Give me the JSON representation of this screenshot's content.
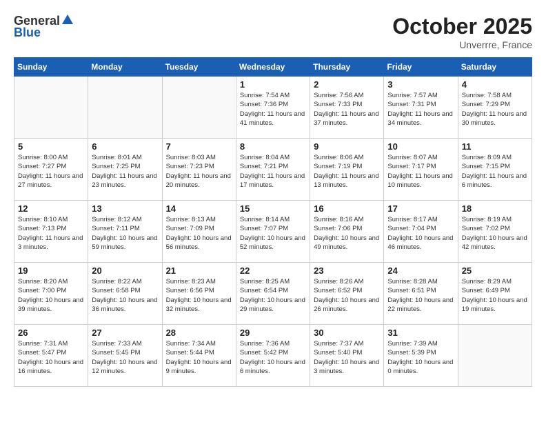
{
  "header": {
    "logo_general": "General",
    "logo_blue": "Blue",
    "month_title": "October 2025",
    "location": "Unverrre, France"
  },
  "days_of_week": [
    "Sunday",
    "Monday",
    "Tuesday",
    "Wednesday",
    "Thursday",
    "Friday",
    "Saturday"
  ],
  "weeks": [
    [
      {
        "day": "",
        "info": ""
      },
      {
        "day": "",
        "info": ""
      },
      {
        "day": "",
        "info": ""
      },
      {
        "day": "1",
        "info": "Sunrise: 7:54 AM\nSunset: 7:36 PM\nDaylight: 11 hours\nand 41 minutes."
      },
      {
        "day": "2",
        "info": "Sunrise: 7:56 AM\nSunset: 7:33 PM\nDaylight: 11 hours\nand 37 minutes."
      },
      {
        "day": "3",
        "info": "Sunrise: 7:57 AM\nSunset: 7:31 PM\nDaylight: 11 hours\nand 34 minutes."
      },
      {
        "day": "4",
        "info": "Sunrise: 7:58 AM\nSunset: 7:29 PM\nDaylight: 11 hours\nand 30 minutes."
      }
    ],
    [
      {
        "day": "5",
        "info": "Sunrise: 8:00 AM\nSunset: 7:27 PM\nDaylight: 11 hours\nand 27 minutes."
      },
      {
        "day": "6",
        "info": "Sunrise: 8:01 AM\nSunset: 7:25 PM\nDaylight: 11 hours\nand 23 minutes."
      },
      {
        "day": "7",
        "info": "Sunrise: 8:03 AM\nSunset: 7:23 PM\nDaylight: 11 hours\nand 20 minutes."
      },
      {
        "day": "8",
        "info": "Sunrise: 8:04 AM\nSunset: 7:21 PM\nDaylight: 11 hours\nand 17 minutes."
      },
      {
        "day": "9",
        "info": "Sunrise: 8:06 AM\nSunset: 7:19 PM\nDaylight: 11 hours\nand 13 minutes."
      },
      {
        "day": "10",
        "info": "Sunrise: 8:07 AM\nSunset: 7:17 PM\nDaylight: 11 hours\nand 10 minutes."
      },
      {
        "day": "11",
        "info": "Sunrise: 8:09 AM\nSunset: 7:15 PM\nDaylight: 11 hours\nand 6 minutes."
      }
    ],
    [
      {
        "day": "12",
        "info": "Sunrise: 8:10 AM\nSunset: 7:13 PM\nDaylight: 11 hours\nand 3 minutes."
      },
      {
        "day": "13",
        "info": "Sunrise: 8:12 AM\nSunset: 7:11 PM\nDaylight: 10 hours\nand 59 minutes."
      },
      {
        "day": "14",
        "info": "Sunrise: 8:13 AM\nSunset: 7:09 PM\nDaylight: 10 hours\nand 56 minutes."
      },
      {
        "day": "15",
        "info": "Sunrise: 8:14 AM\nSunset: 7:07 PM\nDaylight: 10 hours\nand 52 minutes."
      },
      {
        "day": "16",
        "info": "Sunrise: 8:16 AM\nSunset: 7:06 PM\nDaylight: 10 hours\nand 49 minutes."
      },
      {
        "day": "17",
        "info": "Sunrise: 8:17 AM\nSunset: 7:04 PM\nDaylight: 10 hours\nand 46 minutes."
      },
      {
        "day": "18",
        "info": "Sunrise: 8:19 AM\nSunset: 7:02 PM\nDaylight: 10 hours\nand 42 minutes."
      }
    ],
    [
      {
        "day": "19",
        "info": "Sunrise: 8:20 AM\nSunset: 7:00 PM\nDaylight: 10 hours\nand 39 minutes."
      },
      {
        "day": "20",
        "info": "Sunrise: 8:22 AM\nSunset: 6:58 PM\nDaylight: 10 hours\nand 36 minutes."
      },
      {
        "day": "21",
        "info": "Sunrise: 8:23 AM\nSunset: 6:56 PM\nDaylight: 10 hours\nand 32 minutes."
      },
      {
        "day": "22",
        "info": "Sunrise: 8:25 AM\nSunset: 6:54 PM\nDaylight: 10 hours\nand 29 minutes."
      },
      {
        "day": "23",
        "info": "Sunrise: 8:26 AM\nSunset: 6:52 PM\nDaylight: 10 hours\nand 26 minutes."
      },
      {
        "day": "24",
        "info": "Sunrise: 8:28 AM\nSunset: 6:51 PM\nDaylight: 10 hours\nand 22 minutes."
      },
      {
        "day": "25",
        "info": "Sunrise: 8:29 AM\nSunset: 6:49 PM\nDaylight: 10 hours\nand 19 minutes."
      }
    ],
    [
      {
        "day": "26",
        "info": "Sunrise: 7:31 AM\nSunset: 5:47 PM\nDaylight: 10 hours\nand 16 minutes."
      },
      {
        "day": "27",
        "info": "Sunrise: 7:33 AM\nSunset: 5:45 PM\nDaylight: 10 hours\nand 12 minutes."
      },
      {
        "day": "28",
        "info": "Sunrise: 7:34 AM\nSunset: 5:44 PM\nDaylight: 10 hours\nand 9 minutes."
      },
      {
        "day": "29",
        "info": "Sunrise: 7:36 AM\nSunset: 5:42 PM\nDaylight: 10 hours\nand 6 minutes."
      },
      {
        "day": "30",
        "info": "Sunrise: 7:37 AM\nSunset: 5:40 PM\nDaylight: 10 hours\nand 3 minutes."
      },
      {
        "day": "31",
        "info": "Sunrise: 7:39 AM\nSunset: 5:39 PM\nDaylight: 10 hours\nand 0 minutes."
      },
      {
        "day": "",
        "info": ""
      }
    ]
  ]
}
